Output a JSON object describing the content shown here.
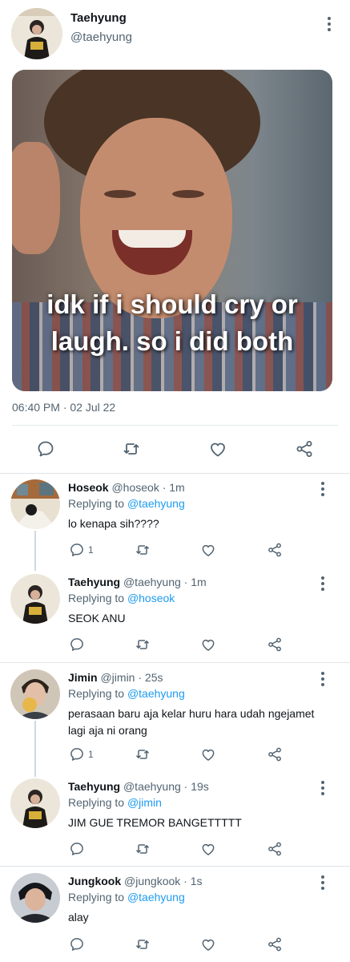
{
  "main_tweet": {
    "name": "Taehyung",
    "handle": "@taehyung",
    "image_caption": "idk if i should cry or laugh. so i did both",
    "timestamp": "06:40 PM · 02 Jul 22"
  },
  "replies": [
    {
      "name": "Hoseok",
      "meta": "@hoseok · 1m",
      "replying_prefix": "Replying to ",
      "replying_to": "@taehyung",
      "text": "lo kenapa sih????",
      "reply_count": "1"
    },
    {
      "name": "Taehyung",
      "meta": "@taehyung · 1m",
      "replying_prefix": "Replying to ",
      "replying_to": "@hoseok",
      "text": "SEOK ANU",
      "reply_count": ""
    },
    {
      "name": "Jimin",
      "meta": "@jimin · 25s",
      "replying_prefix": "Replying to ",
      "replying_to": "@taehyung",
      "text": "perasaan baru aja kelar huru hara udah ngejamet lagi aja ni orang",
      "reply_count": "1"
    },
    {
      "name": "Taehyung",
      "meta": "@taehyung · 19s",
      "replying_prefix": "Replying to ",
      "replying_to": "@jimin",
      "text": "JIM GUE TREMOR BANGETTTTT",
      "reply_count": ""
    },
    {
      "name": "Jungkook",
      "meta": "@jungkook · 1s",
      "replying_prefix": "Replying to ",
      "replying_to": "@taehyung",
      "text": "alay",
      "reply_count": ""
    }
  ],
  "icons": {
    "reply": "speech-bubble",
    "retweet": "retweet-arrows",
    "like": "heart-outline",
    "share": "share-nodes",
    "more": "vertical-ellipsis"
  },
  "colors": {
    "link": "#1d9bf0",
    "secondary_text": "#536471",
    "icon": "#536471"
  }
}
